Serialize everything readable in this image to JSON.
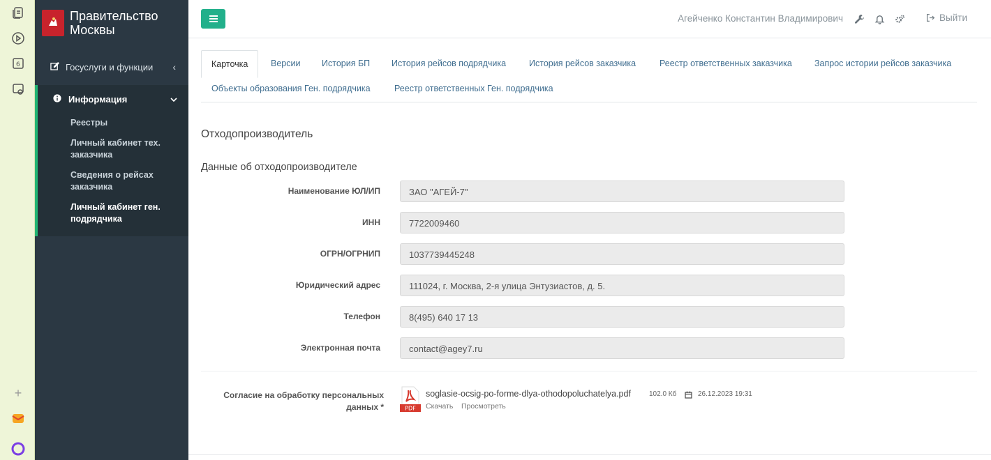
{
  "brand": {
    "title_line1": "Правительство",
    "title_line2": "Москвы"
  },
  "sidebar": {
    "top_item": "Госуслуги и функции",
    "section": "Информация",
    "sub_items": [
      "Реестры",
      "Личный кабинет тех. заказчика",
      "Сведения о рейсах заказчика",
      "Личный кабинет ген. подрядчика"
    ]
  },
  "header": {
    "user": "Агейченко Константин Владимирович",
    "logout": "Выйти"
  },
  "tabs": [
    "Карточка",
    "Версии",
    "История БП",
    "История рейсов подрядчика",
    "История рейсов заказчика",
    "Реестр ответственных заказчика",
    "Запрос истории рейсов заказчика",
    "Объекты образования Ген. подрядчика",
    "Реестр ответственных Ген. подрядчика"
  ],
  "content": {
    "heading": "Отходопроизводитель",
    "section_title": "Данные об отходопроизводителе",
    "fields": [
      {
        "label": "Наименование ЮЛ/ИП",
        "value": "ЗАО \"АГЕЙ-7\""
      },
      {
        "label": "ИНН",
        "value": "7722009460"
      },
      {
        "label": "ОГРН/ОГРНИП",
        "value": "1037739445248"
      },
      {
        "label": "Юридический адрес",
        "value": "111024, г. Москва, 2-я улица Энтузиастов, д. 5."
      },
      {
        "label": "Телефон",
        "value": "8(495) 640 17 13"
      },
      {
        "label": "Электронная почта",
        "value": "contact@agey7.ru"
      }
    ],
    "consent": {
      "label_line1": "Согласие на обработку персональных",
      "label_line2": "данных *",
      "file_name": "soglasie-ocsig-po-forme-dlya-othodopoluchatelya.pdf",
      "file_size": "102.0 Кб",
      "file_date": "26.12.2023 19:31",
      "download": "Скачать",
      "view": "Просмотреть",
      "pdf_badge": "PDF"
    }
  },
  "colors": {
    "sidebar": "#2b3843",
    "accent": "#22b573",
    "menu_button": "#22b08b",
    "link": "#3f6d8f"
  }
}
